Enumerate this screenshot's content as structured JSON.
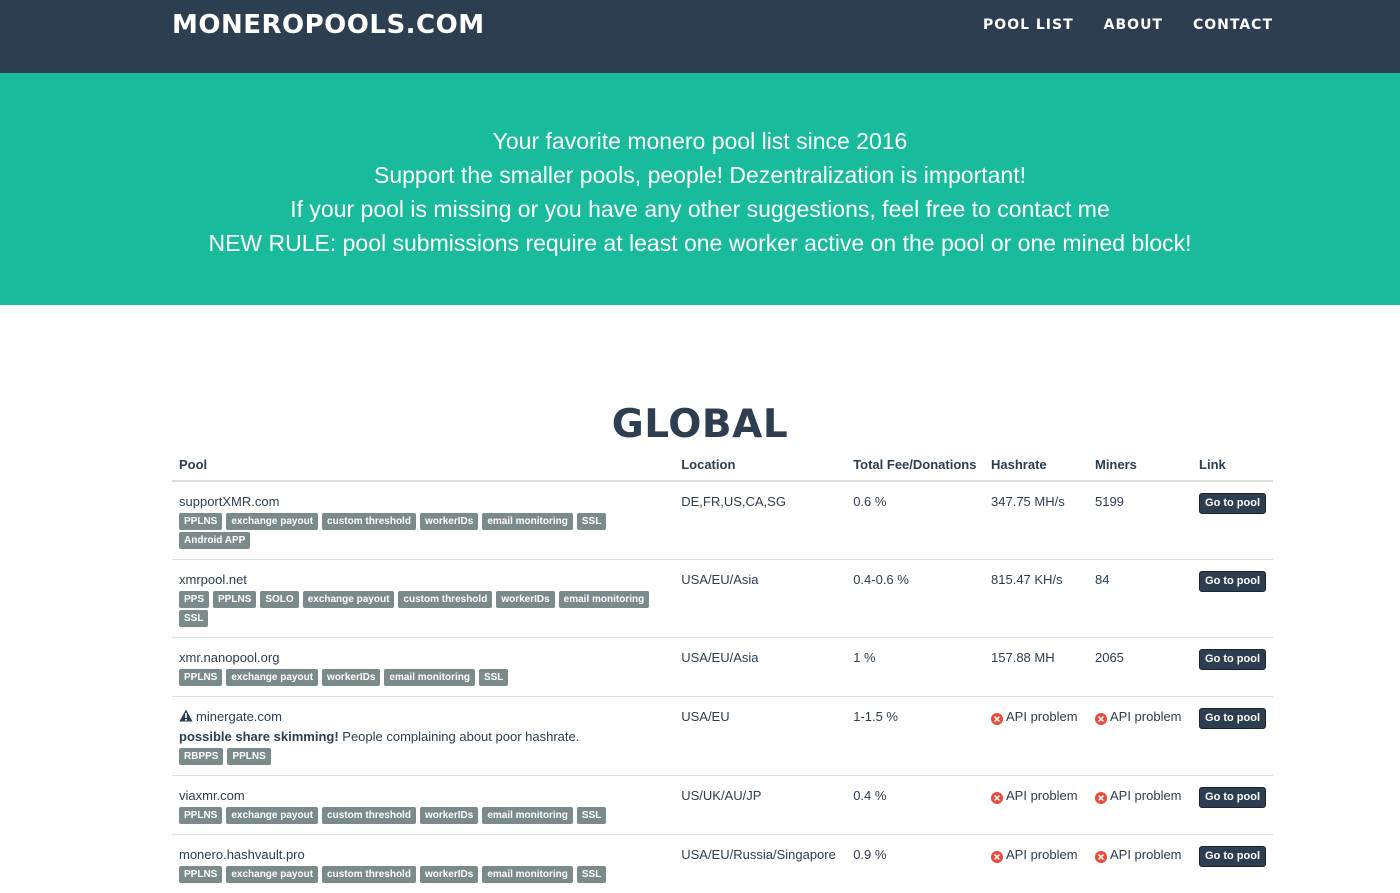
{
  "header": {
    "brand": "MONEROPOOLS.COM",
    "nav": [
      "POOL LIST",
      "ABOUT",
      "CONTACT"
    ]
  },
  "hero": {
    "lines": [
      "Your favorite monero pool list since 2016",
      "Support the smaller pools, people! Dezentralization is important!",
      "If your pool is missing or you have any other suggestions, feel free to contact me",
      "NEW RULE: pool submissions require at least one worker active on the pool or one mined block!"
    ]
  },
  "section": {
    "title": "GLOBAL"
  },
  "table": {
    "columns": [
      "Pool",
      "Location",
      "Total Fee/Donations",
      "Hashrate",
      "Miners",
      "Link"
    ],
    "rows": [
      {
        "name": "supportXMR.com",
        "tags": [
          "PPLNS",
          "exchange payout",
          "custom threshold",
          "workerIDs",
          "email monitoring",
          "SSL",
          "Android APP"
        ],
        "location": "DE,FR,US,CA,SG",
        "fee": "0.6 %",
        "hashrate": "347.75 MH/s",
        "miners": "5199",
        "link": "Go to pool"
      },
      {
        "name": "xmrpool.net",
        "tags": [
          "PPS",
          "PPLNS",
          "SOLO",
          "exchange payout",
          "custom threshold",
          "workerIDs",
          "email monitoring",
          "SSL"
        ],
        "location": "USA/EU/Asia",
        "fee": "0.4-0.6 %",
        "hashrate": "815.47 KH/s",
        "miners": "84",
        "link": "Go to pool"
      },
      {
        "name": "xmr.nanopool.org",
        "tags": [
          "PPLNS",
          "exchange payout",
          "workerIDs",
          "email monitoring",
          "SSL"
        ],
        "location": "USA/EU/Asia",
        "fee": "1 %",
        "hashrate": "157.88 MH",
        "miners": "2065",
        "link": "Go to pool"
      },
      {
        "name": "minergate.com",
        "warning": true,
        "warning_bold": "possible share skimming!",
        "warning_text": " People complaining about poor hashrate.",
        "tags": [
          "RBPPS",
          "PPLNS"
        ],
        "location": "USA/EU",
        "fee": "1-1.5 %",
        "hashrate": "API problem",
        "hashrate_error": true,
        "miners": "API problem",
        "miners_error": true,
        "link": "Go to pool"
      },
      {
        "name": "viaxmr.com",
        "tags": [
          "PPLNS",
          "exchange payout",
          "custom threshold",
          "workerIDs",
          "email monitoring",
          "SSL"
        ],
        "location": "US/UK/AU/JP",
        "fee": "0.4 %",
        "hashrate": "API problem",
        "hashrate_error": true,
        "miners": "API problem",
        "miners_error": true,
        "link": "Go to pool"
      },
      {
        "name": "monero.hashvault.pro",
        "tags": [
          "PPLNS",
          "exchange payout",
          "custom threshold",
          "workerIDs",
          "email monitoring",
          "SSL"
        ],
        "location": "USA/EU/Russia/Singapore",
        "fee": "0.9 %",
        "hashrate": "API problem",
        "hashrate_error": true,
        "miners": "API problem",
        "miners_error": true,
        "link": "Go to pool"
      }
    ]
  },
  "colors": {
    "navbar": "#2c3e50",
    "hero": "#18bc9c",
    "tag": "#7b8a8b",
    "error": "#e74c3c"
  }
}
